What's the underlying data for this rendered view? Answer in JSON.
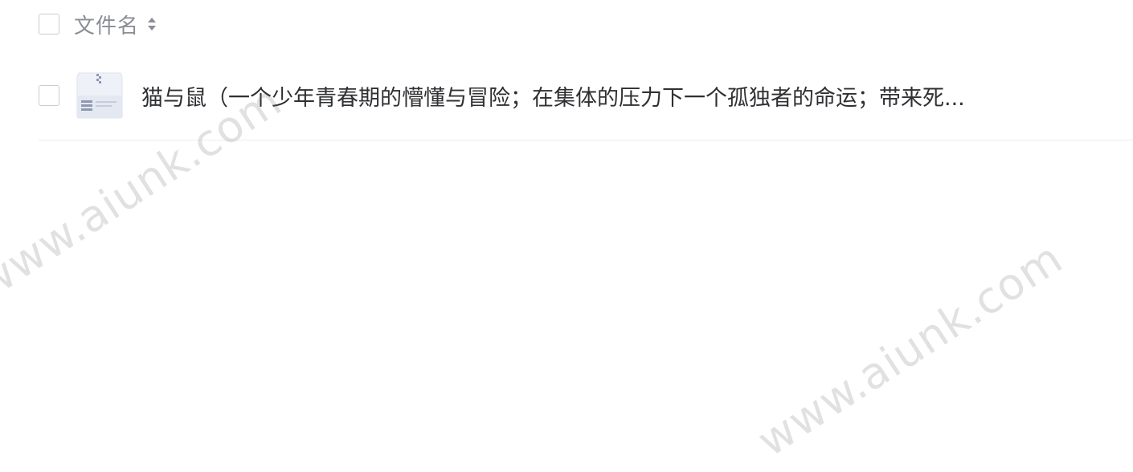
{
  "header": {
    "column_label": "文件名",
    "sort_icon": "sort-icon"
  },
  "files": [
    {
      "name": "猫与鼠（一个少年青春期的懵懂与冒险；在集体的压力下一个孤独者的命运；带来死...",
      "thumbnail_icon": "archive-file-icon"
    }
  ],
  "watermark": {
    "text": "www.aiunk.com"
  }
}
